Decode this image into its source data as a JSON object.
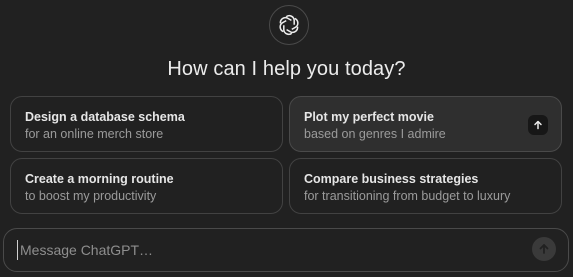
{
  "logo": {
    "icon": "openai-logo-icon"
  },
  "heading": "How can I help you today?",
  "suggestions": [
    {
      "title": "Design a database schema",
      "subtitle": "for an online merch store"
    },
    {
      "title": "Plot my perfect movie",
      "subtitle": "based on genres I admire",
      "action_icon": "arrow-up-icon"
    },
    {
      "title": "Create a morning routine",
      "subtitle": "to boost my productivity"
    },
    {
      "title": "Compare business strategies",
      "subtitle": "for transitioning from budget to luxury"
    }
  ],
  "composer": {
    "placeholder": "Message ChatGPT…",
    "value": "",
    "send_icon": "arrow-up-icon"
  },
  "colors": {
    "background": "#212121",
    "card_border": "#424242",
    "card_hover": "#2f2f2f",
    "text_primary": "#ececec",
    "text_secondary": "#9b9b9b"
  }
}
